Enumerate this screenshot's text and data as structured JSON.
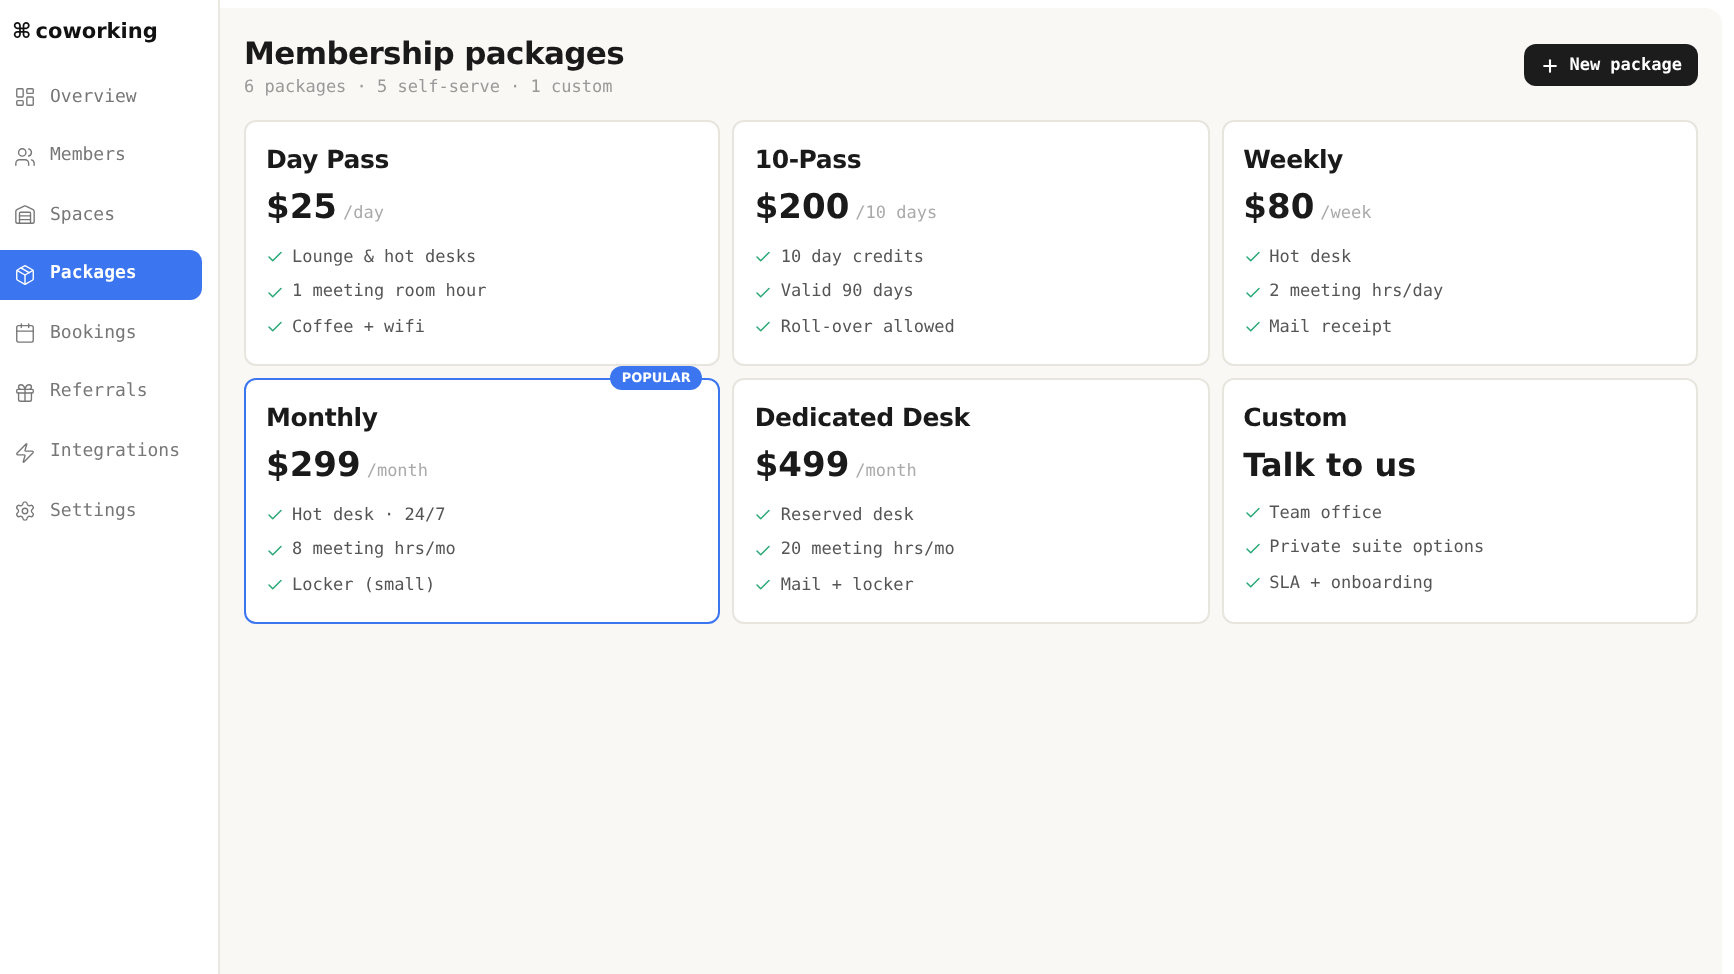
{
  "brand": {
    "glyph": "⌘",
    "name": "coworking"
  },
  "sidebar": {
    "items": [
      {
        "label": "Overview",
        "selected": false
      },
      {
        "label": "Members",
        "selected": false
      },
      {
        "label": "Spaces",
        "selected": false
      },
      {
        "label": "Packages",
        "selected": true
      },
      {
        "label": "Bookings",
        "selected": false
      },
      {
        "label": "Referrals",
        "selected": false
      },
      {
        "label": "Integrations",
        "selected": false
      },
      {
        "label": "Settings",
        "selected": false
      }
    ]
  },
  "header": {
    "title": "Membership packages",
    "subtitle": "6 packages · 5 self-serve · 1 custom",
    "action": {
      "label": "New package"
    }
  },
  "packages": [
    {
      "name": "Day Pass",
      "price": "$25",
      "period": "/day",
      "popular": false,
      "features": [
        "Lounge & hot desks",
        "1 meeting room hour",
        "Coffee + wifi"
      ]
    },
    {
      "name": "10-Pass",
      "price": "$200",
      "period": "/10 days",
      "popular": false,
      "features": [
        "10 day credits",
        "Valid 90 days",
        "Roll-over allowed"
      ]
    },
    {
      "name": "Weekly",
      "price": "$80",
      "period": "/week",
      "popular": false,
      "features": [
        "Hot desk",
        "2 meeting hrs/day",
        "Mail receipt"
      ]
    },
    {
      "name": "Monthly",
      "price": "$299",
      "period": "/month",
      "popular": true,
      "badge": "POPULAR",
      "features": [
        "Hot desk · 24/7",
        "8 meeting hrs/mo",
        "Locker (small)"
      ]
    },
    {
      "name": "Dedicated Desk",
      "price": "$499",
      "period": "/month",
      "popular": false,
      "features": [
        "Reserved desk",
        "20 meeting hrs/mo",
        "Mail + locker"
      ]
    },
    {
      "name": "Custom",
      "price": "Talk to us",
      "popular": false,
      "features": [
        "Team office",
        "Private suite options",
        "SLA + onboarding"
      ]
    }
  ]
}
